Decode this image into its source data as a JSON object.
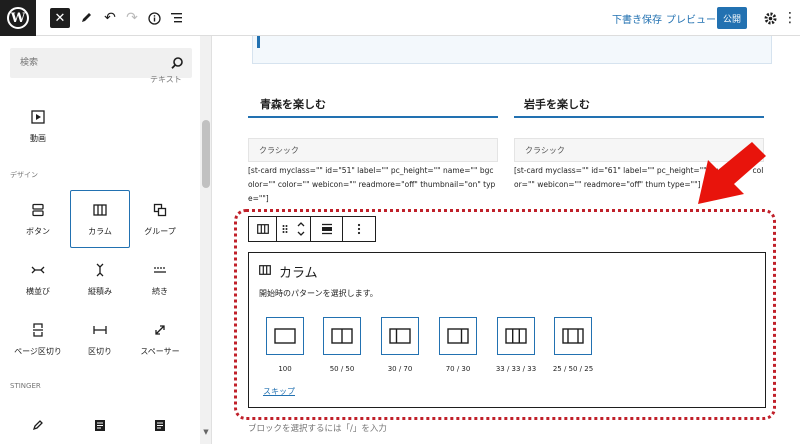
{
  "toolbar": {
    "save_draft": "下書き保存",
    "preview": "プレビュー",
    "publish": "公開"
  },
  "inserter": {
    "search_placeholder": "検索",
    "cut_off_label": "テキスト",
    "video_label": "動画",
    "section_design": "デザイン",
    "section_stinger": "STINGER",
    "design_blocks": [
      {
        "label": "ボタン",
        "icon": "buttons-icon"
      },
      {
        "label": "カラム",
        "icon": "columns-icon",
        "selected": true
      },
      {
        "label": "グループ",
        "icon": "group-icon"
      },
      {
        "label": "横並び",
        "icon": "row-icon"
      },
      {
        "label": "縦積み",
        "icon": "stack-icon"
      },
      {
        "label": "続き",
        "icon": "more-icon"
      },
      {
        "label": "ページ区切り",
        "icon": "page-break-icon"
      },
      {
        "label": "区切り",
        "icon": "separator-icon"
      },
      {
        "label": "スペーサー",
        "icon": "spacer-icon"
      }
    ]
  },
  "editor": {
    "columns": [
      {
        "heading": "青森を楽しむ",
        "classic_label": "クラシック",
        "shortcode": "[st-card myclass=\"\" id=\"51\" label=\"\" pc_height=\"\" name=\"\" bgcolor=\"\" color=\"\" webicon=\"\" readmore=\"off\" thumbnail=\"on\" type=\"\"]"
      },
      {
        "heading": "岩手を楽しむ",
        "classic_label": "クラシック",
        "shortcode": "[st-card myclass=\"\" id=\"61\" label=\"\" pc_height=\"\" bgcolor=\"\" color=\"\" webicon=\"\" readmore=\"off\" thum type=\"\"]"
      }
    ],
    "columns_block": {
      "title": "カラム",
      "instructions": "開始時のパターンを選択します。",
      "variations": [
        "100",
        "50 / 50",
        "30 / 70",
        "70 / 30",
        "33 / 33 / 33",
        "25 / 50 / 25"
      ],
      "skip": "スキップ"
    },
    "appender_hint": "ブロックを選択するには「/」を入力"
  },
  "colors": {
    "accent": "#2271b1",
    "annotation_red": "#c0202a",
    "arrow_red": "#e8140c"
  }
}
